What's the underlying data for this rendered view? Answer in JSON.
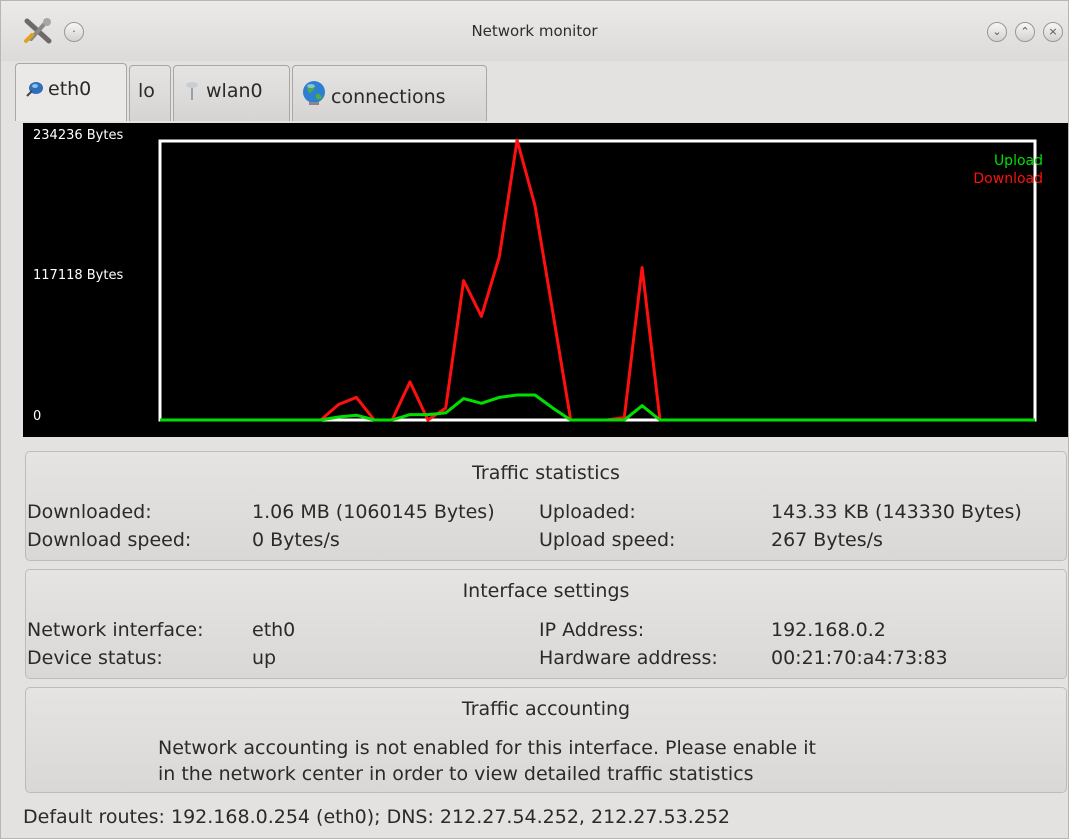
{
  "window": {
    "title": "Network monitor"
  },
  "tabs": [
    {
      "label": "eth0",
      "icon": "network-plug-icon",
      "active": true
    },
    {
      "label": "lo",
      "icon": "",
      "active": false
    },
    {
      "label": "wlan0",
      "icon": "wireless-antenna-icon",
      "active": false
    },
    {
      "label": "connections",
      "icon": "globe-icon",
      "active": false
    }
  ],
  "chart_data": {
    "type": "line",
    "ytick_labels": [
      "234236 Bytes",
      "117118 Bytes",
      "0"
    ],
    "ylim": [
      0,
      234236
    ],
    "grid": false,
    "legend_placement": "top-right",
    "background": "#000000",
    "series": [
      {
        "name": "Upload",
        "color": "#00e000",
        "values": [
          0,
          0,
          0,
          0,
          0,
          0,
          0,
          0,
          0,
          0,
          2500,
          4000,
          0,
          0,
          4500,
          4500,
          6000,
          18000,
          14000,
          19000,
          21000,
          21000,
          10000,
          0,
          0,
          0,
          0,
          12000,
          0,
          0,
          0,
          0,
          0,
          0,
          0,
          0,
          0,
          0,
          0,
          0,
          0,
          0,
          0,
          0,
          0,
          0,
          0,
          0,
          0,
          0
        ]
      },
      {
        "name": "Download",
        "color": "#ff1010",
        "values": [
          0,
          0,
          0,
          0,
          0,
          0,
          0,
          0,
          0,
          0,
          13000,
          19000,
          0,
          0,
          32000,
          0,
          10000,
          117000,
          87000,
          137000,
          235000,
          180000,
          90000,
          0,
          0,
          0,
          2000,
          128000,
          0,
          0,
          0,
          0,
          0,
          0,
          0,
          0,
          0,
          0,
          0,
          0,
          0,
          0,
          0,
          0,
          0,
          0,
          0,
          0,
          0,
          0
        ]
      }
    ]
  },
  "traffic_statistics": {
    "title": "Traffic statistics",
    "downloaded_label": "Downloaded:",
    "downloaded_value": "1.06 MB (1060145 Bytes)",
    "uploaded_label": "Uploaded:",
    "uploaded_value": "143.33 KB (143330 Bytes)",
    "download_speed_label": "Download speed:",
    "download_speed_value": "0 Bytes/s",
    "upload_speed_label": "Upload speed:",
    "upload_speed_value": "267 Bytes/s"
  },
  "interface_settings": {
    "title": "Interface settings",
    "network_interface_label": "Network interface:",
    "network_interface_value": "eth0",
    "device_status_label": "Device status:",
    "device_status_value": "up",
    "ip_address_label": "IP Address:",
    "ip_address_value": "192.168.0.2",
    "hardware_address_label": "Hardware address:",
    "hardware_address_value": "00:21:70:a4:73:83"
  },
  "traffic_accounting": {
    "title": "Traffic accounting",
    "line1": "Network accounting is not enabled for this interface. Please enable it",
    "line2": "in the network center in order to view detailed traffic statistics"
  },
  "status": {
    "text": "Default routes: 192.168.0.254 (eth0); DNS: 212.27.54.252, 212.27.53.252"
  }
}
